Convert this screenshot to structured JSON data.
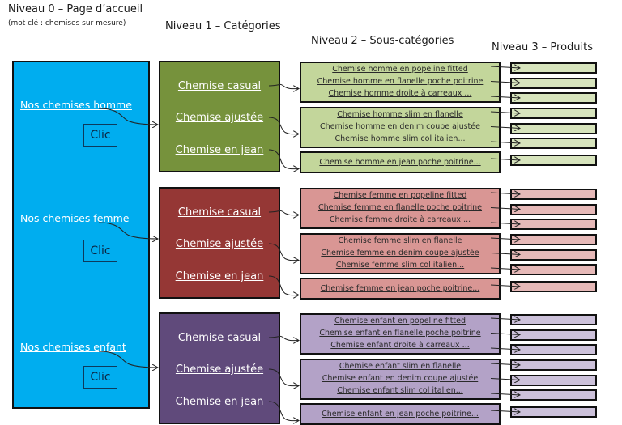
{
  "headers": {
    "level0_title": "Niveau 0 – Page d’accueil",
    "level0_subtitle": "(mot clé : chemises sur mesure)",
    "level1_title": "Niveau 1 – Catégories",
    "level2_title": "Niveau 2 – Sous-catégories",
    "level3_title": "Niveau 3 – Produits"
  },
  "colors": {
    "home": "#00adef",
    "homme_category": "#76923c",
    "homme_sub": "#c3d69b",
    "homme_prod": "#d7e4bd",
    "femme_category": "#953735",
    "femme_sub": "#d99694",
    "femme_prod": "#e6b9b8",
    "enfant_category": "#604a7b",
    "enfant_sub": "#b3a2c7",
    "enfant_prod": "#ccc1da"
  },
  "home": {
    "click_label": "Clic",
    "links": [
      "Nos chemises homme",
      "Nos chemises femme",
      "Nos chemises enfant"
    ]
  },
  "groups": [
    {
      "name": "homme",
      "categories": [
        "Chemise casual",
        "Chemise ajustée",
        "Chemise en jean"
      ],
      "subcategories": [
        [
          "Chemise homme en popeline fitted",
          "Chemise homme en flanelle poche poitrine",
          "Chemise homme droite à carreaux ..."
        ],
        [
          "Chemise homme slim en flanelle",
          "Chemise homme en denim coupe ajustée",
          "Chemise homme slim col italien..."
        ],
        [
          "Chemise homme en jean poche poitrine..."
        ]
      ]
    },
    {
      "name": "femme",
      "categories": [
        "Chemise casual",
        "Chemise ajustée",
        "Chemise en jean"
      ],
      "subcategories": [
        [
          "Chemise femme en popeline fitted",
          "Chemise femme en flanelle poche poitrine",
          "Chemise femme droite à carreaux ..."
        ],
        [
          "Chemise femme slim en flanelle",
          "Chemise femme en denim coupe ajustée",
          "Chemise femme slim col italien..."
        ],
        [
          "Chemise femme en jean poche poitrine..."
        ]
      ]
    },
    {
      "name": "enfant",
      "categories": [
        "Chemise casual",
        "Chemise ajustée",
        "Chemise en jean"
      ],
      "subcategories": [
        [
          "Chemise enfant en popeline fitted",
          "Chemise enfant en flanelle poche poitrine",
          "Chemise enfant droite à carreaux ..."
        ],
        [
          "Chemise enfant slim en flanelle",
          "Chemise enfant en denim coupe ajustée",
          "Chemise enfant slim col italien..."
        ],
        [
          "Chemise enfant en jean poche poitrine..."
        ]
      ]
    }
  ]
}
